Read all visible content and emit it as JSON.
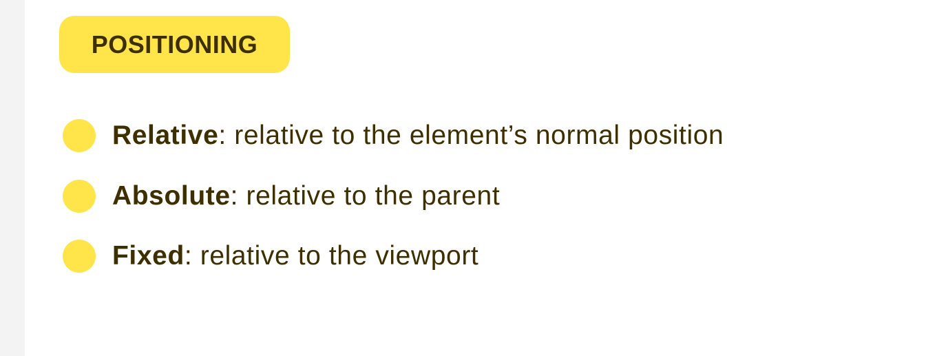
{
  "badge": {
    "label": "POSITIONING"
  },
  "items": [
    {
      "term": "Relative",
      "desc": ": relative to the element’s normal position"
    },
    {
      "term": "Absolute",
      "desc": ": relative to the parent"
    },
    {
      "term": "Fixed",
      "desc": ": relative to the viewport"
    }
  ],
  "colors": {
    "accent": "#ffe44a",
    "text": "#3d2f00",
    "strip": "#f3f3f3"
  }
}
